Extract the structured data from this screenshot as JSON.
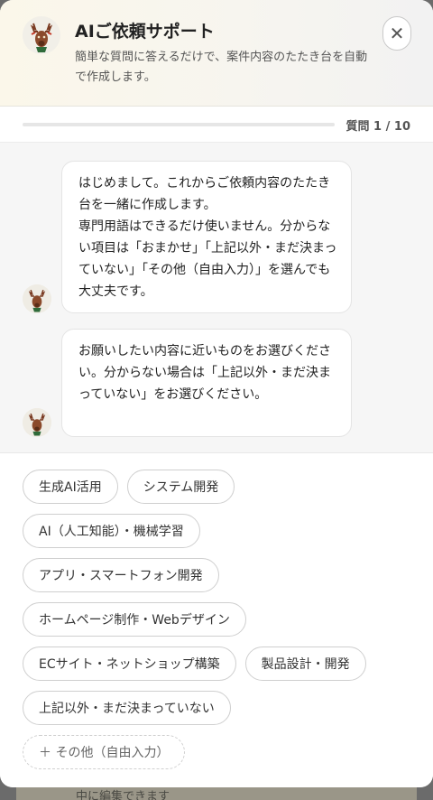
{
  "header": {
    "title": "AIご依頼サポート",
    "description": "簡単な質問に答えるだけで、案件内容のたたき台を自動で作成します。",
    "avatar_icon": "deer-mascot-icon",
    "close_icon": "close-icon",
    "close_symbol": "✕"
  },
  "progress": {
    "label": "質問 1 / 10",
    "current": 1,
    "total": 10
  },
  "messages": [
    {
      "text": "はじめまして。これからご依頼内容のたたき台を一緒に作成します。\n専門用語はできるだけ使いません。分からない項目は「おまかせ」「上記以外・まだ決まっていない」「その他（自由入力）」を選んでも大丈夫です。"
    },
    {
      "text": "お願いしたい内容に近いものをお選びください。分からない場合は「上記以外・まだ決まっていない」をお選びください。"
    }
  ],
  "options": [
    "生成AI活用",
    "システム開発",
    "AI（人工知能）・機械学習",
    "アプリ・スマートフォン開発",
    "ホームページ制作・Webデザイン",
    "ECサイト・ネットショップ構築",
    "製品設計・開発",
    "上記以外・まだ決まっていない",
    "＋ その他（自由入力）"
  ],
  "background": {
    "partial_text": "中に編集できます"
  },
  "colors": {
    "header_gradient_start": "#fbf7ea",
    "chat_background": "#f6f6f6",
    "chip_border": "#cfcfcf"
  }
}
